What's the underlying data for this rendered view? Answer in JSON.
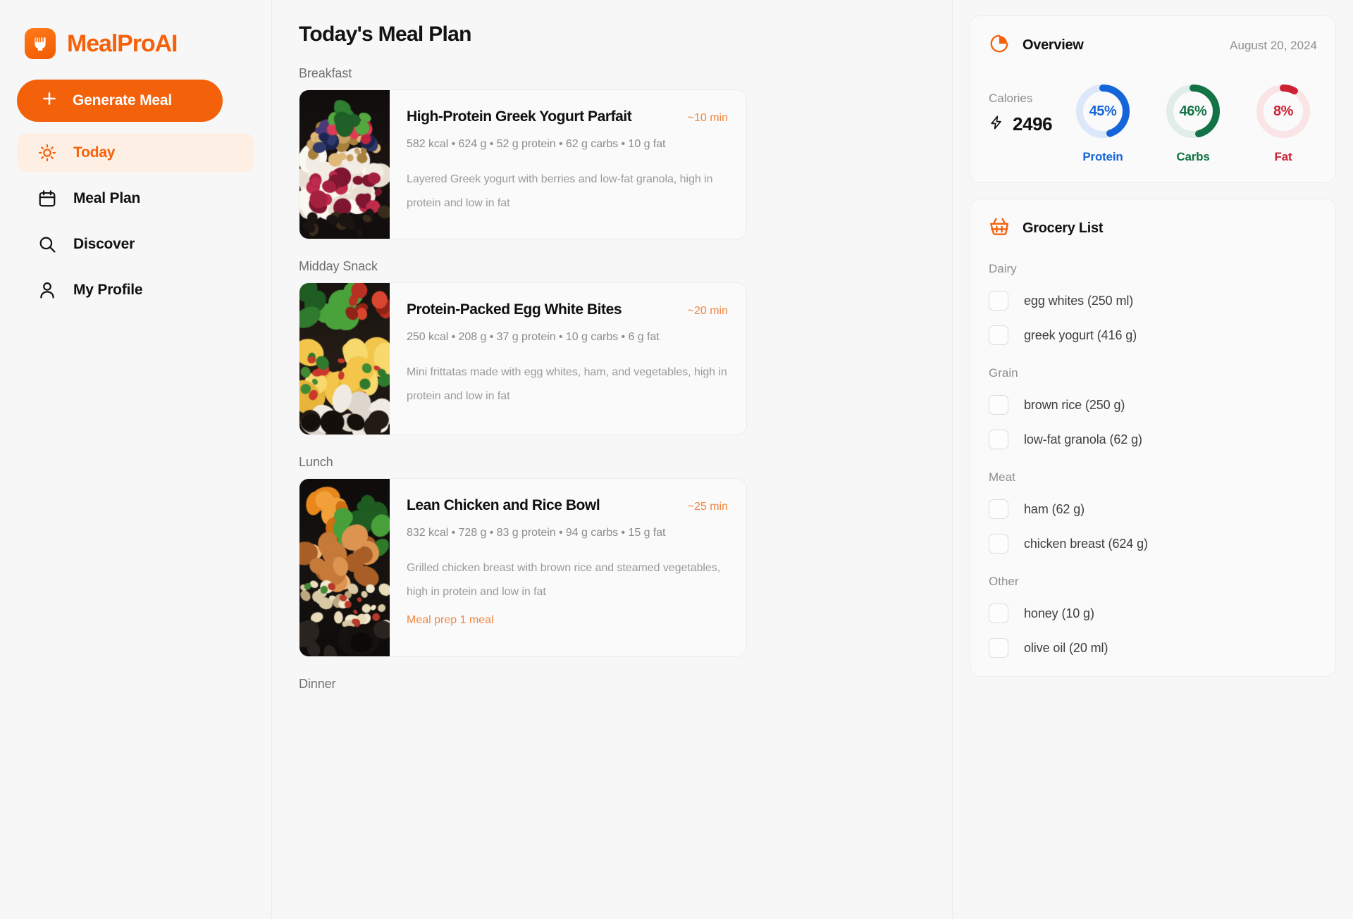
{
  "brand": {
    "name": "MealProAI",
    "mark_icon": "mealproai-logo-icon",
    "accent": "#F4610B"
  },
  "sidebar": {
    "generate_button": {
      "label": "Generate Meal",
      "icon": "plus-icon"
    },
    "items": [
      {
        "label": "Today",
        "icon": "sun-icon",
        "active": true
      },
      {
        "label": "Meal Plan",
        "icon": "calendar-icon",
        "active": false
      },
      {
        "label": "Discover",
        "icon": "search-icon",
        "active": false
      },
      {
        "label": "My Profile",
        "icon": "user-icon",
        "active": false
      }
    ]
  },
  "main": {
    "page_title": "Today's Meal Plan",
    "sections": [
      {
        "label": "Breakfast",
        "meal": {
          "name": "High-Protein Greek Yogurt Parfait",
          "time": "~10 min",
          "macros": "582 kcal • 624 g • 52 g protein • 62 g carbs • 10 g fat",
          "description": "Layered Greek yogurt with berries and low-fat granola, high in protein and low in fat",
          "prep": "",
          "image": "greek-yogurt-parfait-photo"
        }
      },
      {
        "label": "Midday Snack",
        "meal": {
          "name": "Protein-Packed Egg White Bites",
          "time": "~20 min",
          "macros": "250 kcal • 208 g • 37 g protein • 10 g carbs • 6 g fat",
          "description": "Mini frittatas made with egg whites, ham, and vegetables, high in protein and low in fat",
          "prep": "",
          "image": "egg-white-bites-photo"
        }
      },
      {
        "label": "Lunch",
        "meal": {
          "name": "Lean Chicken and Rice Bowl",
          "time": "~25 min",
          "macros": "832 kcal • 728 g • 83 g protein • 94 g carbs • 15 g fat",
          "description": "Grilled chicken breast with brown rice and steamed vegetables, high in protein and low in fat",
          "prep": "Meal prep 1 meal",
          "image": "chicken-rice-bowl-photo"
        }
      },
      {
        "label": "Dinner",
        "meal": null
      }
    ]
  },
  "overview": {
    "title": "Overview",
    "icon": "pie-chart-icon",
    "date": "August 20, 2024",
    "calories_label": "Calories",
    "calories_value": "2496",
    "calories_icon": "lightning-bolt-icon"
  },
  "chart_data": {
    "type": "pie",
    "title": "Overview",
    "subtitle": "August 20, 2024",
    "rings": [
      {
        "name": "Protein",
        "value": 45,
        "display": "45%",
        "color": "#1565D8",
        "track": "#DCE8FA"
      },
      {
        "name": "Carbs",
        "value": 46,
        "display": "46%",
        "color": "#127347",
        "track": "#E1EDE8"
      },
      {
        "name": "Fat",
        "value": 8,
        "display": "8%",
        "color": "#CC2233",
        "track": "#FAE4E6"
      }
    ],
    "center_metric": {
      "label": "Calories",
      "value": 2496
    },
    "ylim": [
      0,
      100
    ],
    "legend": "below-each-ring"
  },
  "grocery": {
    "title": "Grocery List",
    "icon": "shopping-basket-icon",
    "groups": [
      {
        "label": "Dairy",
        "items": [
          "egg whites (250 ml)",
          "greek yogurt (416 g)"
        ]
      },
      {
        "label": "Grain",
        "items": [
          "brown rice (250 g)",
          "low-fat granola (62 g)"
        ]
      },
      {
        "label": "Meat",
        "items": [
          "ham (62 g)",
          "chicken breast (624 g)"
        ]
      },
      {
        "label": "Other",
        "items": [
          "honey (10 g)",
          "olive oil (20 ml)"
        ]
      }
    ]
  }
}
